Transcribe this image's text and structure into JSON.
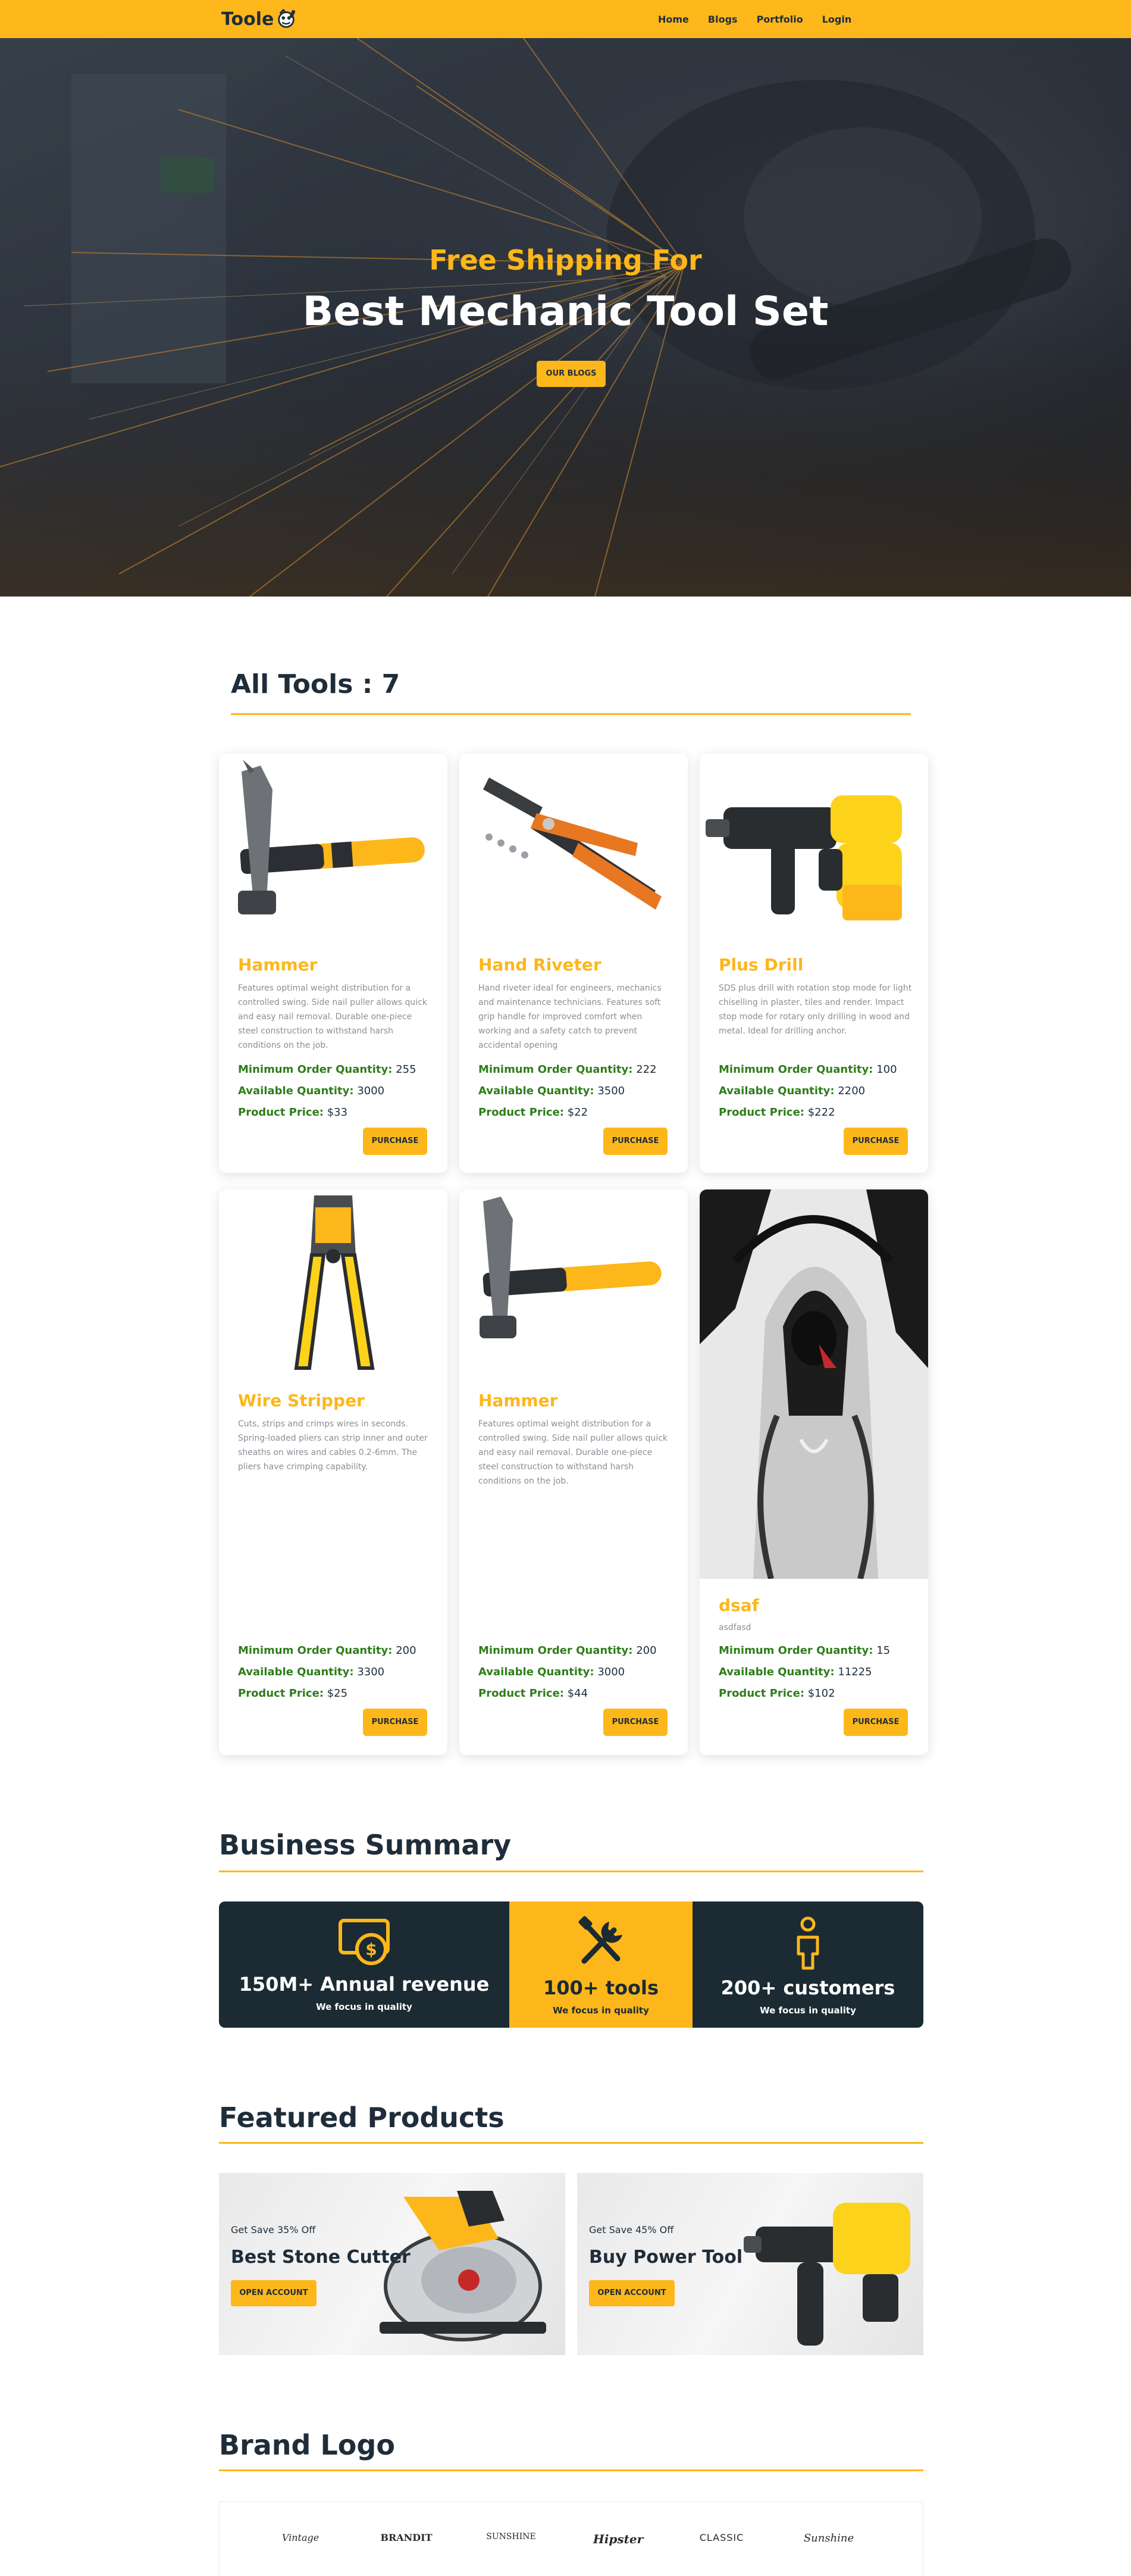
{
  "nav": {
    "logo_text": "Toole",
    "links": [
      "Home",
      "Blogs",
      "Portfolio",
      "Login"
    ]
  },
  "hero": {
    "subtitle": "Free Shipping For",
    "title": "Best Mechanic Tool Set",
    "button": "OUR BLOGS"
  },
  "tools": {
    "heading": "All Tools : 7",
    "labels": {
      "min_order": "Minimum Order Quantity:",
      "available": "Available Quantity:",
      "price": "Product Price:"
    },
    "purchase_label": "PURCHASE",
    "items": [
      {
        "name": "Hammer",
        "image_icon": "hammer-image",
        "description": "Features optimal weight distribution for a controlled swing. Side nail puller allows quick and easy nail removal. Durable one-piece steel construction to withstand harsh conditions on the job.",
        "min_order": "255",
        "available": "3000",
        "price": "$33"
      },
      {
        "name": "Hand Riveter",
        "image_icon": "hand-riveter-image",
        "description": "Hand riveter ideal for engineers, mechanics and maintenance technicians. Features soft grip handle for improved comfort when working and a safety catch to prevent accidental opening",
        "min_order": "222",
        "available": "3500",
        "price": "$22"
      },
      {
        "name": "Plus Drill",
        "image_icon": "plus-drill-image",
        "description": "SDS plus drill with rotation stop mode for light chiselling in plaster, tiles and render. Impact stop mode for rotary only drilling in wood and metal. Ideal for drilling anchor.",
        "min_order": "100",
        "available": "2200",
        "price": "$222"
      },
      {
        "name": "Wire Stripper",
        "image_icon": "wire-stripper-image",
        "description": "Cuts, strips and crimps wires in seconds. Spring-loaded pliers can strip inner and outer sheaths on wires and cables 0.2-6mm. The pliers have crimping capability.",
        "min_order": "200",
        "available": "3300",
        "price": "$25"
      },
      {
        "name": "Hammer",
        "image_icon": "hammer-image",
        "description": "Features optimal weight distribution for a controlled swing. Side nail puller allows quick and easy nail removal. Durable one-piece steel construction to withstand harsh conditions on the job.",
        "min_order": "200",
        "available": "3000",
        "price": "$44"
      },
      {
        "name": "dsaf",
        "image_icon": "hooded-figure-image",
        "description": "asdfasd",
        "min_order": "15",
        "available": "11225",
        "price": "$102"
      }
    ]
  },
  "summary": {
    "heading": "Business Summary",
    "items": [
      {
        "icon": "money-icon",
        "value": "150M+ Annual revenue",
        "caption": "We focus in quality"
      },
      {
        "icon": "tools-icon",
        "value": "100+ tools",
        "caption": "We focus in quality"
      },
      {
        "icon": "person-icon",
        "value": "200+ customers",
        "caption": "We focus in quality"
      }
    ],
    "colors": {
      "dark": "#1b2a33",
      "accent": "#fdb71b"
    }
  },
  "featured": {
    "heading": "Featured Products",
    "items": [
      {
        "small": "Get Save 35% Off",
        "title": "Best Stone Cutter",
        "button": "OPEN ACCOUNT",
        "icon": "circular-saw-image"
      },
      {
        "small": "Get Save 45% Off",
        "title": "Buy Power Tool",
        "button": "OPEN ACCOUNT",
        "icon": "rotary-hammer-image"
      }
    ]
  },
  "brands": {
    "heading": "Brand Logo",
    "items": [
      "Vintage",
      "BRANDIT",
      "SUNSHINE",
      "Hipster",
      "CLASSIC",
      "Sunshine"
    ]
  },
  "theme": {
    "accent": "#fdb71b",
    "dark": "#1f2d3a",
    "green": "#2e7d1a"
  }
}
